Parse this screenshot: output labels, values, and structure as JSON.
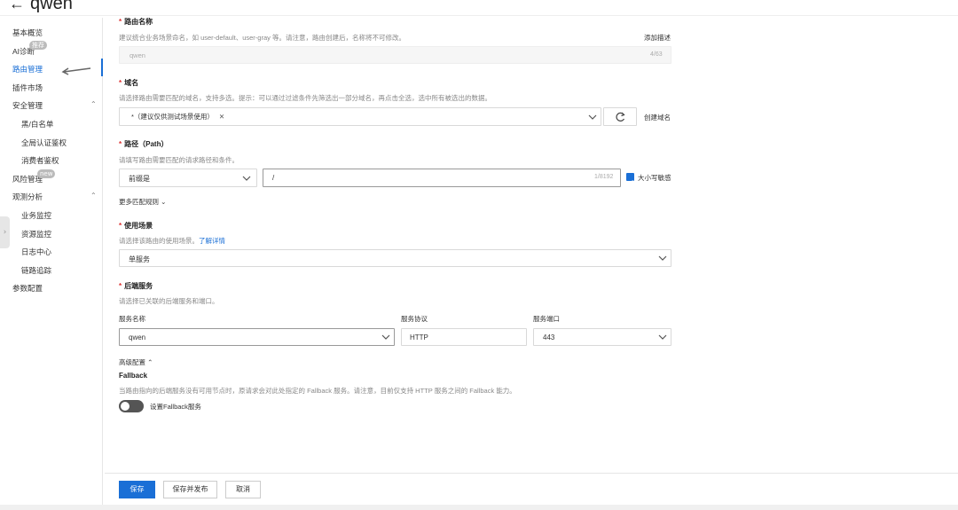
{
  "header": {
    "back_icon": "arrow-left-icon",
    "title": "qwen"
  },
  "sidebar": {
    "items": [
      {
        "label": "基本概览"
      },
      {
        "label": "AI诊断",
        "badge": "推荐"
      },
      {
        "label": "路由管理",
        "active": true
      },
      {
        "label": "插件市场"
      },
      {
        "label": "安全管理"
      },
      {
        "label": "黑/白名单"
      },
      {
        "label": "全局认证鉴权"
      },
      {
        "label": "消费者鉴权"
      },
      {
        "label": "风险管理",
        "badge": "new"
      },
      {
        "label": "观测分析"
      },
      {
        "label": "业务监控"
      },
      {
        "label": "资源监控"
      },
      {
        "label": "日志中心"
      },
      {
        "label": "链路追踪"
      },
      {
        "label": "参数配置"
      }
    ]
  },
  "form": {
    "route_name": {
      "label": "路由名称",
      "hint": "建议统合业务场景命名，如 user-default、user-gray 等。请注意，路由创建后，名称将不可修改。",
      "add_desc": "添加描述",
      "value": "qwen",
      "counter": "4/63"
    },
    "domain": {
      "label": "域名",
      "hint": "请选择路由需要匹配的域名，支持多选。提示：可以通过过滤条件先筛选出一部分域名，再点击全选，选中所有被选出的数据。",
      "tag": "*（建议仅供测试场景使用）",
      "create_link": "创建域名",
      "refresh_icon": "refresh-icon"
    },
    "path": {
      "label": "路径（Path）",
      "hint": "请填写路由需要匹配的请求路径和条件。",
      "match_type": "前缀是",
      "value": "/",
      "counter": "1/8192",
      "case_sensitive": "大小写敏感",
      "more_rules": "更多匹配规则"
    },
    "scenario": {
      "label": "使用场景",
      "hint_prefix": "请选择该路由的使用场景。",
      "hint_link": "了解详情",
      "value": "单服务"
    },
    "backend": {
      "label": "后端服务",
      "hint": "请选择已关联的后端服务和端口。",
      "col_name": "服务名称",
      "col_protocol": "服务协议",
      "col_port": "服务端口",
      "name": "qwen",
      "protocol": "HTTP",
      "port": "443"
    },
    "advanced": {
      "label": "高级配置",
      "fallback_title": "Fallback",
      "fallback_hint": "当路由指向的后端服务没有可用节点时，原请求会对此处指定的 Fallback 服务。请注意，目前仅支持 HTTP 服务之间的 Fallback 能力。",
      "toggle_label": "设置Fallback服务"
    }
  },
  "actions": {
    "save": "保存",
    "save_publish": "保存并发布",
    "cancel": "取消"
  }
}
